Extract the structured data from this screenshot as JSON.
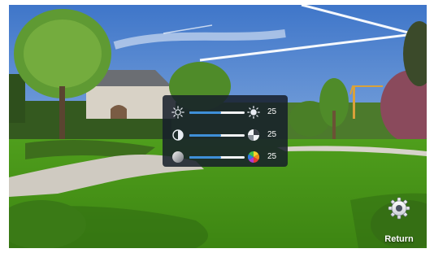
{
  "adjust_panel": {
    "brightness": {
      "value": 25,
      "level": 0.57,
      "icon_low": "sun-outline-icon",
      "icon_high": "sun-filled-icon"
    },
    "contrast": {
      "value": 25,
      "level": 0.57,
      "icon_low": "half-circle-icon",
      "icon_high": "contrast-icon"
    },
    "saturation": {
      "value": 25,
      "level": 0.57,
      "icon_low": "gray-circle-icon",
      "icon_high": "color-wheel-icon"
    }
  },
  "return_button": {
    "label": "Return",
    "icon": "gear-icon"
  },
  "colors": {
    "accent": "#3f8fd8",
    "panel_bg": "#161e2a",
    "text": "#ffffff"
  }
}
